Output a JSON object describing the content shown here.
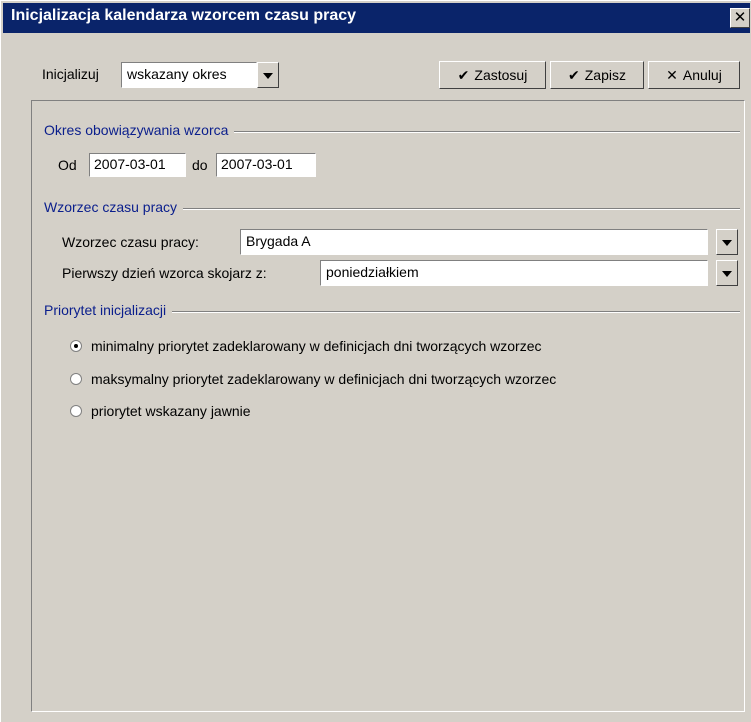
{
  "window": {
    "title": "Inicjalizacja kalendarza wzorcem czasu pracy",
    "close_glyph": "✕"
  },
  "toolbar": {
    "init_label": "Inicjalizuj",
    "init_value": "wskazany okres",
    "apply": {
      "icon": "checkmark-icon",
      "glyph": "✔",
      "label": "Zastosuj"
    },
    "save": {
      "icon": "checkmark-icon",
      "glyph": "✔",
      "label": "Zapisz"
    },
    "cancel": {
      "icon": "close-icon",
      "glyph": "✕",
      "label": "Anuluj"
    }
  },
  "period": {
    "title": "Okres obowiązywania wzorca",
    "from_label": "Od",
    "from_value": "2007-03-01",
    "to_label": "do",
    "to_value": "2007-03-01"
  },
  "pattern": {
    "title": "Wzorzec czasu pracy",
    "pattern_label": "Wzorzec czasu pracy:",
    "pattern_value": "Brygada A",
    "first_day_label": "Pierwszy dzień wzorca skojarz z:",
    "first_day_value": "poniedziałkiem"
  },
  "priority": {
    "title": "Priorytet inicjalizacji",
    "options": [
      {
        "label": "minimalny priorytet zadeklarowany w definicjach dni tworzących wzorzec",
        "checked": true
      },
      {
        "label": "maksymalny priorytet zadeklarowany w definicjach dni tworzących wzorzec",
        "checked": false
      },
      {
        "label": "priorytet wskazany jawnie",
        "checked": false
      }
    ]
  },
  "colors": {
    "titlebar": "#0a246a",
    "group_title": "#0a1e8c",
    "face": "#d4d0c8"
  }
}
